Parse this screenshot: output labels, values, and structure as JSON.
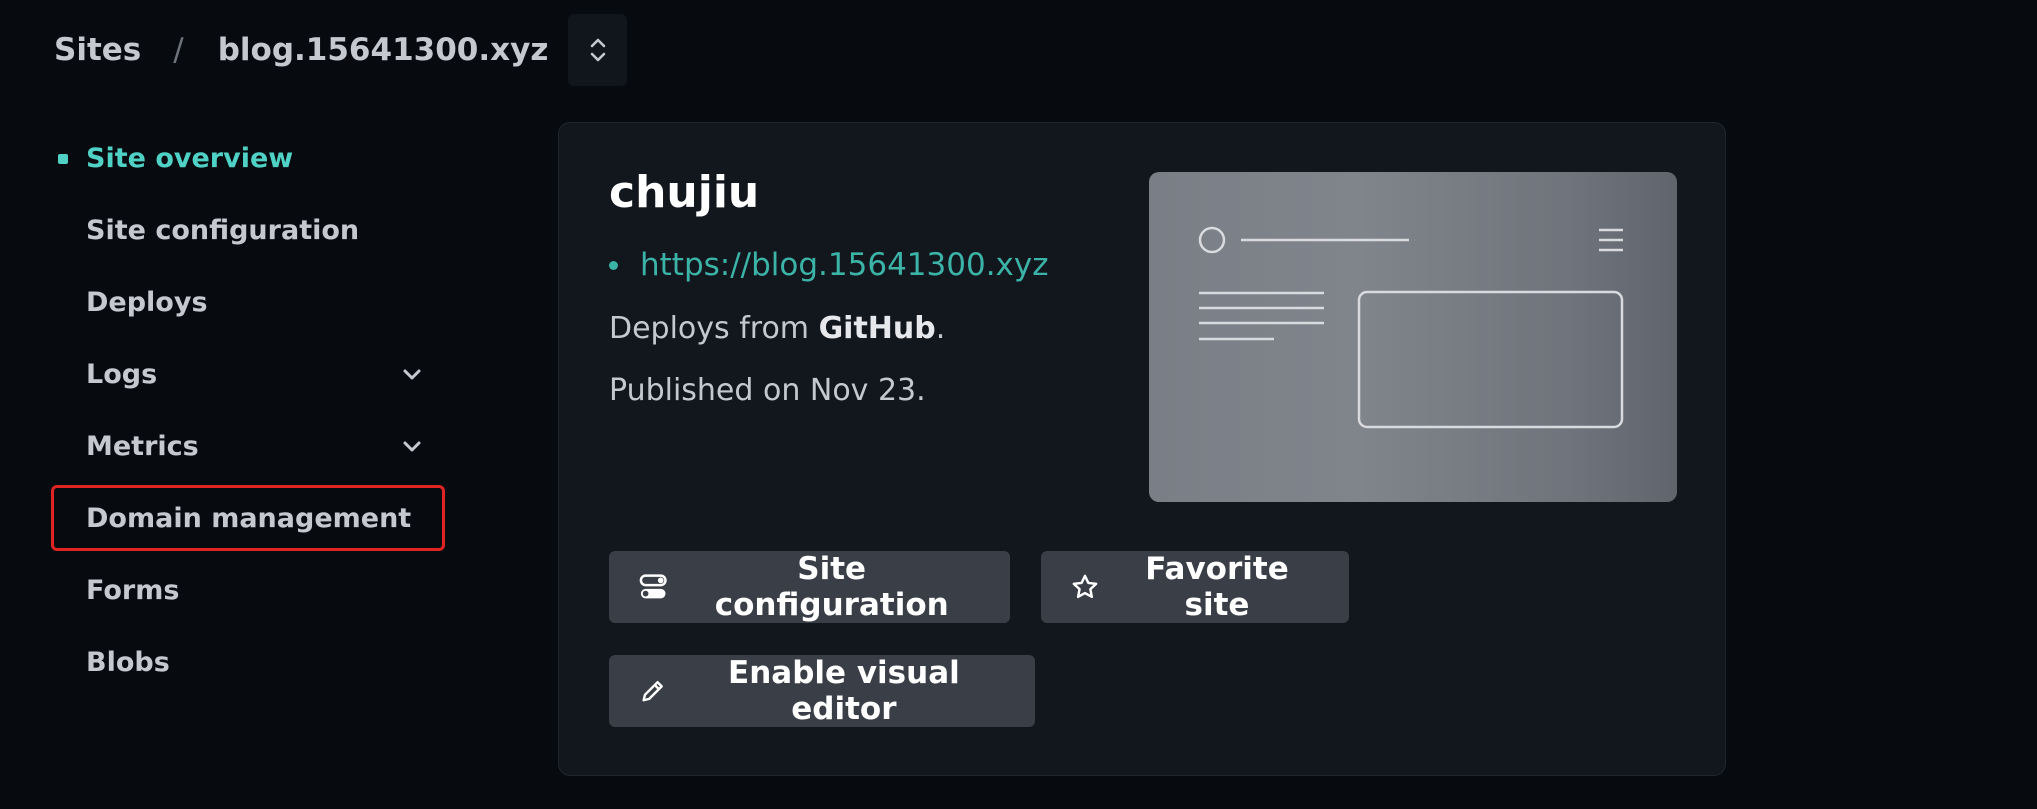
{
  "breadcrumb": {
    "root": "Sites",
    "separator": "/",
    "current": "blog.15641300.xyz"
  },
  "sidebar": {
    "items": [
      {
        "label": "Site overview",
        "active": true
      },
      {
        "label": "Site configuration"
      },
      {
        "label": "Deploys"
      },
      {
        "label": "Logs",
        "expandable": true
      },
      {
        "label": "Metrics",
        "expandable": true
      },
      {
        "label": "Domain management",
        "highlighted": true
      },
      {
        "label": "Forms"
      },
      {
        "label": "Blobs"
      }
    ]
  },
  "card": {
    "site_name": "chujiu",
    "url": "https://blog.15641300.xyz",
    "deploys_prefix": "Deploys from ",
    "deploys_source": "GitHub",
    "deploys_suffix": ".",
    "published": "Published on Nov 23.",
    "buttons": {
      "config": "Site configuration",
      "favorite": "Favorite site",
      "editor": "Enable visual editor"
    }
  },
  "colors": {
    "accent": "#4fd1c5",
    "highlight_border": "#e02424",
    "link": "#3bb3a6"
  }
}
